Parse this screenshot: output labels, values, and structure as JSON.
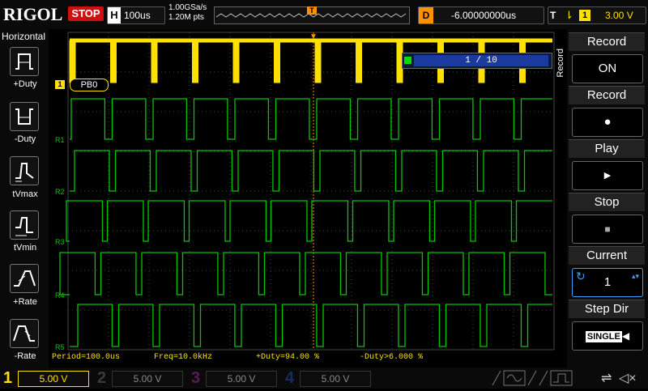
{
  "top": {
    "logo": "RIGOL",
    "run_state": "STOP",
    "horizontal_label": "H",
    "timebase": "100us",
    "sample_rate": "1.00GSa/s",
    "memory_depth": "1.20M pts",
    "delay_label": "D",
    "delay_value": "-6.00000000us",
    "trigger_label": "T",
    "trigger_icon": "edge-falling-icon",
    "trigger_channel": "1",
    "trigger_level": "3.00 V",
    "trigger_marker": "T"
  },
  "left": {
    "title": "Horizontal",
    "buttons": [
      {
        "label": "+Duty",
        "icon": "plus-duty-icon"
      },
      {
        "label": "-Duty",
        "icon": "minus-duty-icon"
      },
      {
        "label": "tVmax",
        "icon": "tvmax-icon"
      },
      {
        "label": "tVmin",
        "icon": "tvmin-icon"
      },
      {
        "label": "+Rate",
        "icon": "plus-rate-icon"
      },
      {
        "label": "-Rate",
        "icon": "minus-rate-icon"
      }
    ]
  },
  "scope": {
    "record_progress": "1 / 10",
    "channel1_marker": "1",
    "channel1_label": "PB0",
    "ref_labels": [
      "R1",
      "R2",
      "R3",
      "R4",
      "R5"
    ],
    "colors": {
      "ch1": "#ffe000",
      "ref": "#00c800",
      "grid": "#444444"
    }
  },
  "right": {
    "side_label": "Record",
    "groups": [
      {
        "title": "Record",
        "value": "ON"
      },
      {
        "title": "Record",
        "value": "●"
      },
      {
        "title": "Play",
        "value": "▶"
      },
      {
        "title": "Stop",
        "value": "■"
      },
      {
        "title": "Current",
        "value": "1"
      },
      {
        "title": "Step Dir",
        "value": "SINGLE"
      }
    ]
  },
  "measurements": {
    "period": "Period=100.0us",
    "freq": "Freq=10.0kHz",
    "pos_duty": "+Duty=94.00 %",
    "neg_duty": "-Duty>6.000 %"
  },
  "bottom": {
    "channels": [
      {
        "num": "1",
        "value": "5.00 V",
        "color": "#ffe000"
      },
      {
        "num": "2",
        "value": "5.00 V",
        "color": "#1e90ff"
      },
      {
        "num": "3",
        "value": "5.00 V",
        "color": "#c000c0"
      },
      {
        "num": "4",
        "value": "5.00 V",
        "color": "#2060ff"
      }
    ]
  }
}
